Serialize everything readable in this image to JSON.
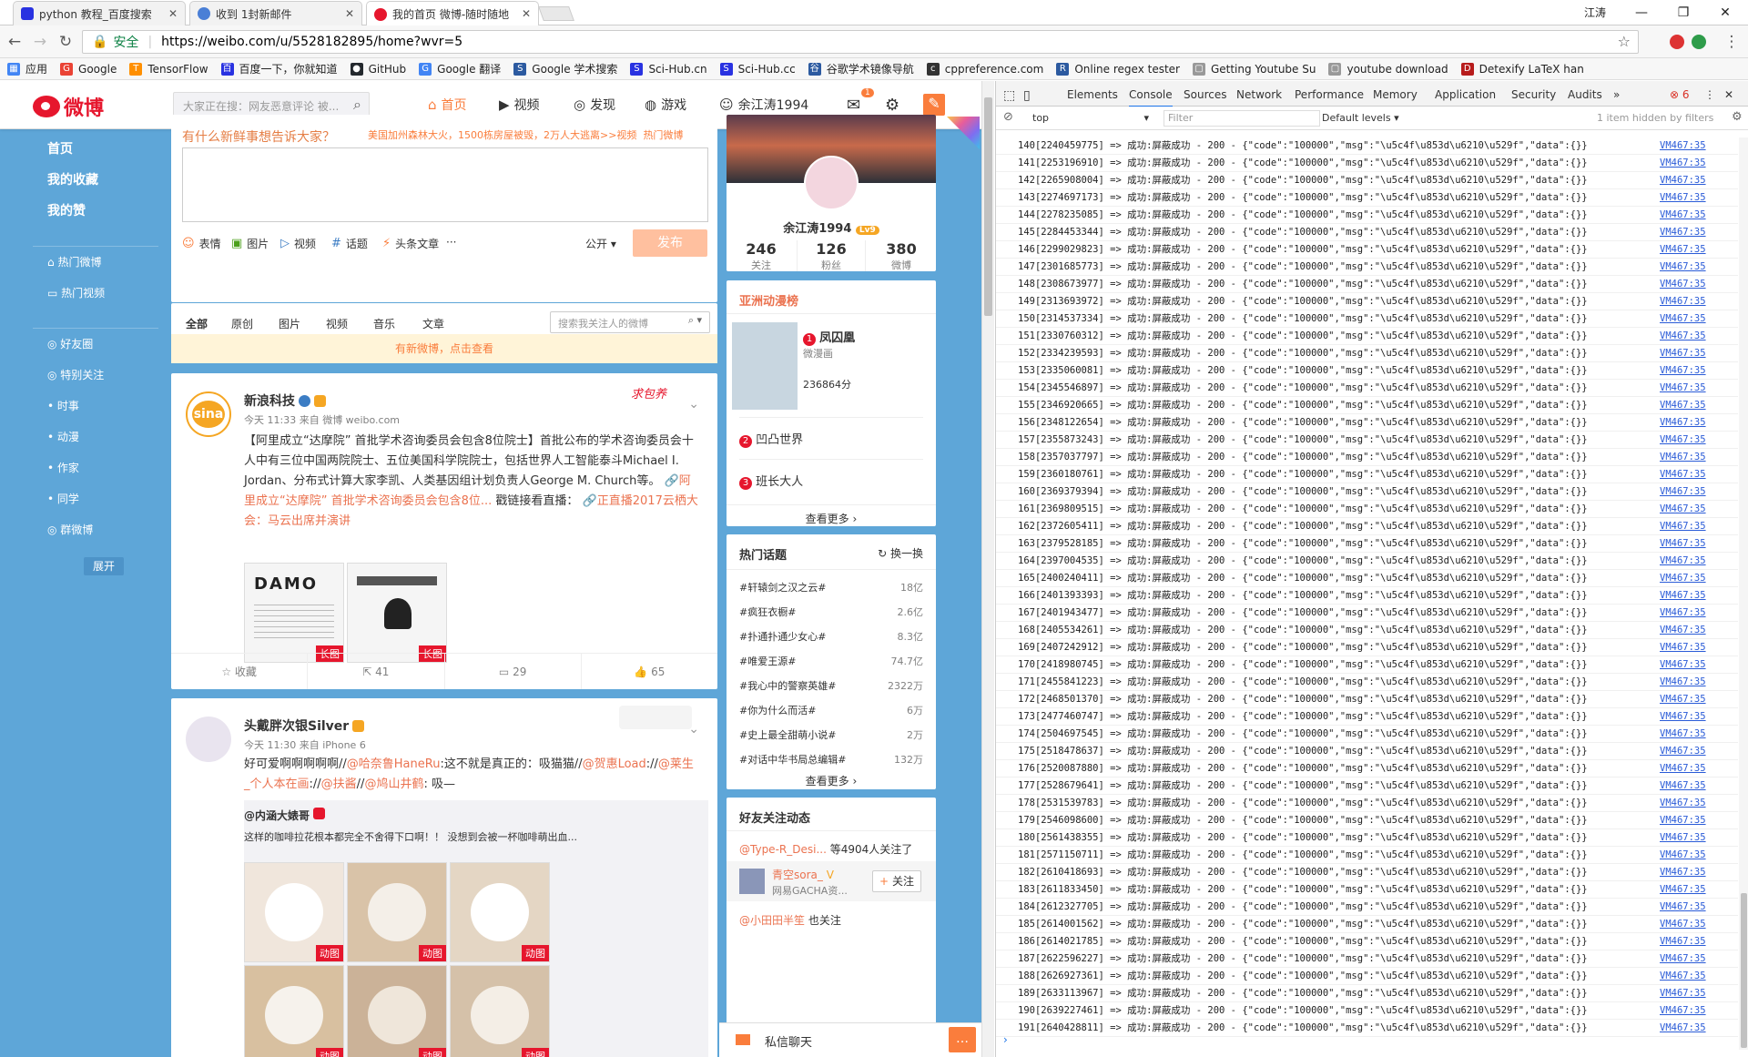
{
  "browser": {
    "tabs": [
      {
        "title": "python 教程_百度搜索"
      },
      {
        "title": "收到 1封新邮件"
      },
      {
        "title": "我的首页 微博-随时随地"
      }
    ],
    "user": "江涛",
    "nav": {
      "secure_label": "安全",
      "url": "https://weibo.com/u/5528182895/home?wvr=5"
    },
    "bookmarks": [
      "应用",
      "Google",
      "TensorFlow",
      "百度一下，你就知道",
      "GitHub",
      "Google 翻译",
      "Google 学术搜索",
      "Sci-Hub.cn",
      "Sci-Hub.cc",
      "谷歌学术镜像导航",
      "cppreference.com",
      "Online regex tester",
      "Getting Youtube Su",
      "youtube download",
      "Detexify LaTeX han"
    ]
  },
  "weibo": {
    "logo_text": "微博",
    "search_placeholder": "大家正在搜：网友恶意评论 被...",
    "nav": [
      "首页",
      "视频",
      "发现",
      "游戏",
      "余江涛1994"
    ],
    "message_count": "1",
    "left_nav": {
      "main": [
        "首页",
        "我的收藏",
        "我的赞"
      ],
      "hot": [
        "热门微博",
        "热门视频"
      ],
      "groups": [
        "好友圈",
        "特别关注",
        "时事",
        "动漫",
        "作家",
        "同学",
        "群微博"
      ],
      "expand": "展开"
    },
    "publisher": {
      "prompt": "有什么新鲜事想告诉大家？",
      "hot_topic": "美国加州森林大火，1500栋房屋被毁，2万人大逃离>>视频",
      "hot_label": "热门微博",
      "tools": [
        "表情",
        "图片",
        "视频",
        "话题",
        "头条文章",
        "···"
      ],
      "visibility": "公开",
      "submit": "发布"
    },
    "feed_tabs": [
      "全部",
      "原创",
      "图片",
      "视频",
      "音乐",
      "文章"
    ],
    "feed_search_placeholder": "搜索我关注人的微博",
    "new_notice": "有新微博，点击查看",
    "post1": {
      "author": "新浪科技",
      "sticker": "求包养",
      "time": "今天 11:33 来自 微博 weibo.com",
      "text": "【阿里成立“达摩院” 首批学术咨询委员会包含8位院士】首批公布的学术咨询委员会十人中有三位中国两院院士、五位美国科学院院士，包括世界人工智能泰斗Michael I. Jordan、分布式计算大家李凯、人类基因组计划负责人George M. Church等。",
      "link1": "阿里成立“达摩院” 首批学术咨询委员会包含8位...",
      "text2": "戳链接看直播：",
      "link2": "正直播2017云栖大会：马云出席并演讲",
      "image_tags": [
        "长图",
        "长图"
      ],
      "image_text": "DAMO",
      "actions": [
        "收藏",
        "41",
        "29",
        "65"
      ]
    },
    "post2": {
      "author": "头戴胖次银Silver",
      "time": "今天 11:30 来自 iPhone 6",
      "text": "好可爱啊啊啊啊啊//",
      "mention1": "@哈奈鲁HaneRu",
      "text_b": ":这不就是真正的：吸猫猫//",
      "mention2": "@贺惠Load",
      "text_c": "://",
      "mention3": "@莱生_个人本在画",
      "text_d": "://",
      "mention4": "@扶酱",
      "text_e": "//",
      "mention5": "@鸠山井鹤",
      "text_f": ": 吸—",
      "repost_author": "@内涵大婊哥",
      "repost_text": "这样的咖啡拉花根本都完全不舍得下口啊！！",
      "repost_text2": "没想到会被一杯咖啡萌出血...",
      "image_tags": [
        "动图",
        "动图",
        "动图",
        "动图",
        "动图",
        "动图"
      ]
    },
    "profile": {
      "name": "余江涛1994",
      "level": "Lv9",
      "stats": [
        {
          "value": "246",
          "label": "关注"
        },
        {
          "value": "126",
          "label": "粉丝"
        },
        {
          "value": "380",
          "label": "微博"
        }
      ]
    },
    "anime_rank": {
      "title": "亚洲动漫榜",
      "items": [
        {
          "rank": "1",
          "name": "凤囚凰",
          "sub": "微漫画",
          "score": "236864分"
        },
        {
          "rank": "2",
          "name": "凹凸世界"
        },
        {
          "rank": "3",
          "name": "班长大人"
        }
      ],
      "more": "查看更多"
    },
    "hot_topics": {
      "title": "热门话题",
      "refresh": "换一换",
      "items": [
        {
          "name": "#轩辕剑之汉之云#",
          "count": "18亿"
        },
        {
          "name": "#疯狂衣橱#",
          "count": "2.6亿"
        },
        {
          "name": "#扑通扑通少女心#",
          "count": "8.3亿"
        },
        {
          "name": "#唯爱王源#",
          "count": "74.7亿"
        },
        {
          "name": "#我心中的警察英雄#",
          "count": "2322万"
        },
        {
          "name": "#你为什么而活#",
          "count": "6万"
        },
        {
          "name": "#史上最全甜萌小说#",
          "count": "2万"
        },
        {
          "name": "#对话中华书局总编辑#",
          "count": "132万"
        }
      ],
      "more": "查看更多"
    },
    "friends_activity": {
      "title": "好友关注动态",
      "line1_user": "@Type-R_Desi...",
      "line1_text": "等4904人关注了",
      "user": "青空sora_",
      "user_sub": "网易GACHA资...",
      "follow": "关注",
      "line3_user": "@小田田半笙",
      "line3_text": "也关注"
    },
    "chat": "私信聊天"
  },
  "devtools": {
    "tabs": [
      "Elements",
      "Console",
      "Sources",
      "Network",
      "Performance",
      "Memory",
      "Application",
      "Security",
      "Audits"
    ],
    "error_count": "6",
    "context": "top",
    "filter_placeholder": "Filter",
    "levels": "Default levels",
    "hidden": "1 item hidden by filters",
    "source": "VM467:35",
    "log_lines": [
      "140[2240459775] => 成功:屏蔽成功 - 200 - {\"code\":\"100000\",\"msg\":\"\\u5c4f\\u853d\\u6210\\u529f\",\"data\":{}}",
      "141[2253196910] => 成功:屏蔽成功 - 200 - {\"code\":\"100000\",\"msg\":\"\\u5c4f\\u853d\\u6210\\u529f\",\"data\":{}}",
      "142[2265908004] => 成功:屏蔽成功 - 200 - {\"code\":\"100000\",\"msg\":\"\\u5c4f\\u853d\\u6210\\u529f\",\"data\":{}}",
      "143[2274697173] => 成功:屏蔽成功 - 200 - {\"code\":\"100000\",\"msg\":\"\\u5c4f\\u853d\\u6210\\u529f\",\"data\":{}}",
      "144[2278235085] => 成功:屏蔽成功 - 200 - {\"code\":\"100000\",\"msg\":\"\\u5c4f\\u853d\\u6210\\u529f\",\"data\":{}}",
      "145[2284453344] => 成功:屏蔽成功 - 200 - {\"code\":\"100000\",\"msg\":\"\\u5c4f\\u853d\\u6210\\u529f\",\"data\":{}}",
      "146[2299029823] => 成功:屏蔽成功 - 200 - {\"code\":\"100000\",\"msg\":\"\\u5c4f\\u853d\\u6210\\u529f\",\"data\":{}}",
      "147[2301685773] => 成功:屏蔽成功 - 200 - {\"code\":\"100000\",\"msg\":\"\\u5c4f\\u853d\\u6210\\u529f\",\"data\":{}}",
      "148[2308673977] => 成功:屏蔽成功 - 200 - {\"code\":\"100000\",\"msg\":\"\\u5c4f\\u853d\\u6210\\u529f\",\"data\":{}}",
      "149[2313693972] => 成功:屏蔽成功 - 200 - {\"code\":\"100000\",\"msg\":\"\\u5c4f\\u853d\\u6210\\u529f\",\"data\":{}}",
      "150[2314537334] => 成功:屏蔽成功 - 200 - {\"code\":\"100000\",\"msg\":\"\\u5c4f\\u853d\\u6210\\u529f\",\"data\":{}}",
      "151[2330760312] => 成功:屏蔽成功 - 200 - {\"code\":\"100000\",\"msg\":\"\\u5c4f\\u853d\\u6210\\u529f\",\"data\":{}}",
      "152[2334239593] => 成功:屏蔽成功 - 200 - {\"code\":\"100000\",\"msg\":\"\\u5c4f\\u853d\\u6210\\u529f\",\"data\":{}}",
      "153[2335060081] => 成功:屏蔽成功 - 200 - {\"code\":\"100000\",\"msg\":\"\\u5c4f\\u853d\\u6210\\u529f\",\"data\":{}}",
      "154[2345546897] => 成功:屏蔽成功 - 200 - {\"code\":\"100000\",\"msg\":\"\\u5c4f\\u853d\\u6210\\u529f\",\"data\":{}}",
      "155[2346920665] => 成功:屏蔽成功 - 200 - {\"code\":\"100000\",\"msg\":\"\\u5c4f\\u853d\\u6210\\u529f\",\"data\":{}}",
      "156[2348122654] => 成功:屏蔽成功 - 200 - {\"code\":\"100000\",\"msg\":\"\\u5c4f\\u853d\\u6210\\u529f\",\"data\":{}}",
      "157[2355873243] => 成功:屏蔽成功 - 200 - {\"code\":\"100000\",\"msg\":\"\\u5c4f\\u853d\\u6210\\u529f\",\"data\":{}}",
      "158[2357037797] => 成功:屏蔽成功 - 200 - {\"code\":\"100000\",\"msg\":\"\\u5c4f\\u853d\\u6210\\u529f\",\"data\":{}}",
      "159[2360180761] => 成功:屏蔽成功 - 200 - {\"code\":\"100000\",\"msg\":\"\\u5c4f\\u853d\\u6210\\u529f\",\"data\":{}}",
      "160[2369379394] => 成功:屏蔽成功 - 200 - {\"code\":\"100000\",\"msg\":\"\\u5c4f\\u853d\\u6210\\u529f\",\"data\":{}}",
      "161[2369809515] => 成功:屏蔽成功 - 200 - {\"code\":\"100000\",\"msg\":\"\\u5c4f\\u853d\\u6210\\u529f\",\"data\":{}}",
      "162[2372605411] => 成功:屏蔽成功 - 200 - {\"code\":\"100000\",\"msg\":\"\\u5c4f\\u853d\\u6210\\u529f\",\"data\":{}}",
      "163[2379528185] => 成功:屏蔽成功 - 200 - {\"code\":\"100000\",\"msg\":\"\\u5c4f\\u853d\\u6210\\u529f\",\"data\":{}}",
      "164[2397004535] => 成功:屏蔽成功 - 200 - {\"code\":\"100000\",\"msg\":\"\\u5c4f\\u853d\\u6210\\u529f\",\"data\":{}}",
      "165[2400240411] => 成功:屏蔽成功 - 200 - {\"code\":\"100000\",\"msg\":\"\\u5c4f\\u853d\\u6210\\u529f\",\"data\":{}}",
      "166[2401393393] => 成功:屏蔽成功 - 200 - {\"code\":\"100000\",\"msg\":\"\\u5c4f\\u853d\\u6210\\u529f\",\"data\":{}}",
      "167[2401943477] => 成功:屏蔽成功 - 200 - {\"code\":\"100000\",\"msg\":\"\\u5c4f\\u853d\\u6210\\u529f\",\"data\":{}}",
      "168[2405534261] => 成功:屏蔽成功 - 200 - {\"code\":\"100000\",\"msg\":\"\\u5c4f\\u853d\\u6210\\u529f\",\"data\":{}}",
      "169[2407242912] => 成功:屏蔽成功 - 200 - {\"code\":\"100000\",\"msg\":\"\\u5c4f\\u853d\\u6210\\u529f\",\"data\":{}}",
      "170[2418980745] => 成功:屏蔽成功 - 200 - {\"code\":\"100000\",\"msg\":\"\\u5c4f\\u853d\\u6210\\u529f\",\"data\":{}}",
      "171[2455841223] => 成功:屏蔽成功 - 200 - {\"code\":\"100000\",\"msg\":\"\\u5c4f\\u853d\\u6210\\u529f\",\"data\":{}}",
      "172[2468501370] => 成功:屏蔽成功 - 200 - {\"code\":\"100000\",\"msg\":\"\\u5c4f\\u853d\\u6210\\u529f\",\"data\":{}}",
      "173[2477460747] => 成功:屏蔽成功 - 200 - {\"code\":\"100000\",\"msg\":\"\\u5c4f\\u853d\\u6210\\u529f\",\"data\":{}}",
      "174[2504697545] => 成功:屏蔽成功 - 200 - {\"code\":\"100000\",\"msg\":\"\\u5c4f\\u853d\\u6210\\u529f\",\"data\":{}}",
      "175[2518478637] => 成功:屏蔽成功 - 200 - {\"code\":\"100000\",\"msg\":\"\\u5c4f\\u853d\\u6210\\u529f\",\"data\":{}}",
      "176[2520087880] => 成功:屏蔽成功 - 200 - {\"code\":\"100000\",\"msg\":\"\\u5c4f\\u853d\\u6210\\u529f\",\"data\":{}}",
      "177[2528679641] => 成功:屏蔽成功 - 200 - {\"code\":\"100000\",\"msg\":\"\\u5c4f\\u853d\\u6210\\u529f\",\"data\":{}}",
      "178[2531539783] => 成功:屏蔽成功 - 200 - {\"code\":\"100000\",\"msg\":\"\\u5c4f\\u853d\\u6210\\u529f\",\"data\":{}}",
      "179[2546098600] => 成功:屏蔽成功 - 200 - {\"code\":\"100000\",\"msg\":\"\\u5c4f\\u853d\\u6210\\u529f\",\"data\":{}}",
      "180[2561438355] => 成功:屏蔽成功 - 200 - {\"code\":\"100000\",\"msg\":\"\\u5c4f\\u853d\\u6210\\u529f\",\"data\":{}}",
      "181[2571150711] => 成功:屏蔽成功 - 200 - {\"code\":\"100000\",\"msg\":\"\\u5c4f\\u853d\\u6210\\u529f\",\"data\":{}}",
      "182[2610418693] => 成功:屏蔽成功 - 200 - {\"code\":\"100000\",\"msg\":\"\\u5c4f\\u853d\\u6210\\u529f\",\"data\":{}}",
      "183[2611833450] => 成功:屏蔽成功 - 200 - {\"code\":\"100000\",\"msg\":\"\\u5c4f\\u853d\\u6210\\u529f\",\"data\":{}}",
      "184[2612327705] => 成功:屏蔽成功 - 200 - {\"code\":\"100000\",\"msg\":\"\\u5c4f\\u853d\\u6210\\u529f\",\"data\":{}}",
      "185[2614001562] => 成功:屏蔽成功 - 200 - {\"code\":\"100000\",\"msg\":\"\\u5c4f\\u853d\\u6210\\u529f\",\"data\":{}}",
      "186[2614021785] => 成功:屏蔽成功 - 200 - {\"code\":\"100000\",\"msg\":\"\\u5c4f\\u853d\\u6210\\u529f\",\"data\":{}}",
      "187[2622596227] => 成功:屏蔽成功 - 200 - {\"code\":\"100000\",\"msg\":\"\\u5c4f\\u853d\\u6210\\u529f\",\"data\":{}}",
      "188[2626927361] => 成功:屏蔽成功 - 200 - {\"code\":\"100000\",\"msg\":\"\\u5c4f\\u853d\\u6210\\u529f\",\"data\":{}}",
      "189[2633113967] => 成功:屏蔽成功 - 200 - {\"code\":\"100000\",\"msg\":\"\\u5c4f\\u853d\\u6210\\u529f\",\"data\":{}}",
      "190[2639227461] => 成功:屏蔽成功 - 200 - {\"code\":\"100000\",\"msg\":\"\\u5c4f\\u853d\\u6210\\u529f\",\"data\":{}}",
      "191[2640428811] => 成功:屏蔽成功 - 200 - {\"code\":\"100000\",\"msg\":\"\\u5c4f\\u853d\\u6210\\u529f\",\"data\":{}}"
    ]
  }
}
